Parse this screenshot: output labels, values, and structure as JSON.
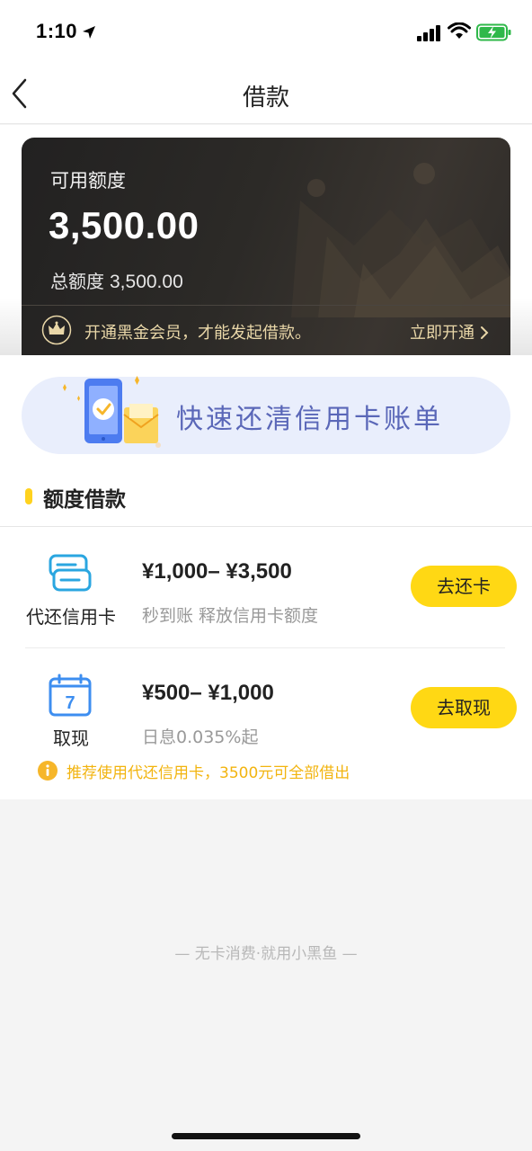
{
  "status_bar": {
    "time": "1:10",
    "icons": [
      "location-arrow-icon",
      "signal-icon",
      "wifi-icon",
      "battery-charging-icon"
    ]
  },
  "nav": {
    "title": "借款",
    "back_icon": "back-chevron-icon"
  },
  "credit_card": {
    "available_label": "可用额度",
    "available_amount": "3,500.00",
    "total_label": "总额度",
    "total_amount": "3,500.00",
    "member_tip": "开通黑金会员，才能发起借款。",
    "member_link": "立即开通",
    "crown_icon": "crown-icon"
  },
  "banner": {
    "text": "快速还清信用卡账单"
  },
  "section": {
    "title": "额度借款"
  },
  "loan_items": [
    {
      "name": "代还信用卡",
      "range": "¥1,000– ¥3,500",
      "desc": "秒到账 释放信用卡额度",
      "button": "去还卡",
      "icon": "card-repay-icon"
    },
    {
      "name": "取现",
      "range": "¥500– ¥1,000",
      "desc": "日息0.035%起",
      "button": "去取现",
      "icon": "calendar-7-icon"
    }
  ],
  "tip": {
    "text": "推荐使用代还信用卡，3500元可全部借出",
    "icon": "info-icon"
  },
  "footer": {
    "text": "— 无卡消费·就用小黑鱼 —"
  },
  "colors": {
    "accent_yellow": "#ffd814",
    "tip_orange": "#f2b40f",
    "banner_text": "#5a67b8",
    "card_dark": "#2a2826",
    "gold": "#e9d7a8"
  }
}
